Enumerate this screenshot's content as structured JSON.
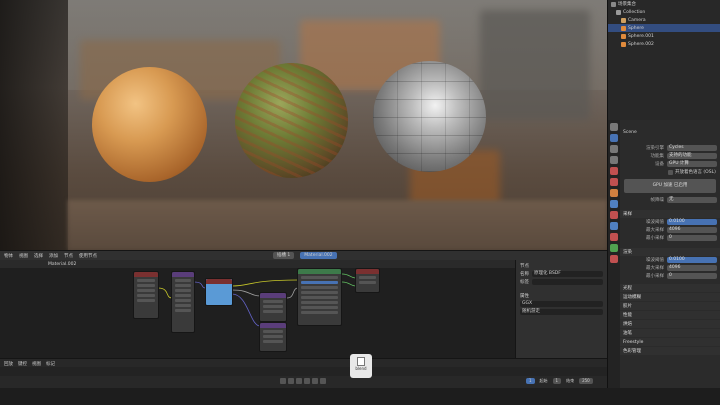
{
  "outliner": {
    "rows": [
      {
        "label": "场景集合",
        "color": "#8a8a8a",
        "selected": false
      },
      {
        "label": "Collection",
        "color": "#9a9a9a",
        "selected": false
      },
      {
        "label": "Camera",
        "color": "#d0a060",
        "selected": false
      },
      {
        "label": "Sphere",
        "color": "#e08a3c",
        "selected": true
      },
      {
        "label": "Sphere.001",
        "color": "#e08a3c",
        "selected": false
      },
      {
        "label": "Sphere.002",
        "color": "#e08a3c",
        "selected": false
      }
    ]
  },
  "properties": {
    "object_name": "Scene",
    "rows": [
      {
        "label": "渲染引擎",
        "value": "Cycles",
        "blue": false
      },
      {
        "label": "功能集",
        "value": "支持的功能",
        "blue": false
      },
      {
        "label": "设备",
        "value": "GPU 计算",
        "blue": false
      }
    ],
    "checkbox_label": "开放着色语言 (OSL)",
    "button_label": "GPU 加速 已启用",
    "denoise_label": "帧降噪",
    "denoise_value": "无",
    "sections": [
      {
        "title": "采样",
        "rows": [
          {
            "label": "噪波阈值",
            "value": "0.0100"
          },
          {
            "label": "最大采样",
            "value": "4096"
          },
          {
            "label": "最小采样",
            "value": "0"
          }
        ]
      },
      {
        "title": "渲染",
        "rows": [
          {
            "label": "噪波阈值",
            "value": "0.0100"
          },
          {
            "label": "最大采样",
            "value": "4096"
          },
          {
            "label": "最小采样",
            "value": "0"
          }
        ]
      }
    ],
    "collapsed": [
      "光程",
      "运动模糊",
      "胶片",
      "性能",
      "烘焙",
      "油笔",
      "Freestyle",
      "色彩管理"
    ]
  },
  "node_editor": {
    "menu": [
      "物体",
      "视图",
      "选择",
      "添加",
      "节点",
      "使用节点"
    ],
    "material_chip": "Material.002",
    "slot_chip": "插槽 1",
    "breadcrumb": "Material.002"
  },
  "node_sidebar": {
    "tabs": [
      "节点",
      "工具",
      "视图",
      "选项"
    ],
    "rows": [
      {
        "label": "名称",
        "value": "原理化 BSDF"
      },
      {
        "label": "标签",
        "value": ""
      }
    ],
    "section": "属性",
    "props": [
      "GGX",
      "随机游走"
    ]
  },
  "timeline": {
    "menu": [
      "回放",
      "键控",
      "视图",
      "标记"
    ],
    "frame_start_label": "起始",
    "frame_start": "1",
    "frame_end_label": "结束",
    "frame_end": "250",
    "current_frame": "1"
  },
  "file_tooltip": {
    "label": "blend"
  },
  "colors": {
    "accent_blue": "#4772b3",
    "node_shader": "#3d7a4a",
    "node_texture": "#7a3030",
    "node_vector": "#5a3d7a",
    "node_color": "#b0b040"
  }
}
